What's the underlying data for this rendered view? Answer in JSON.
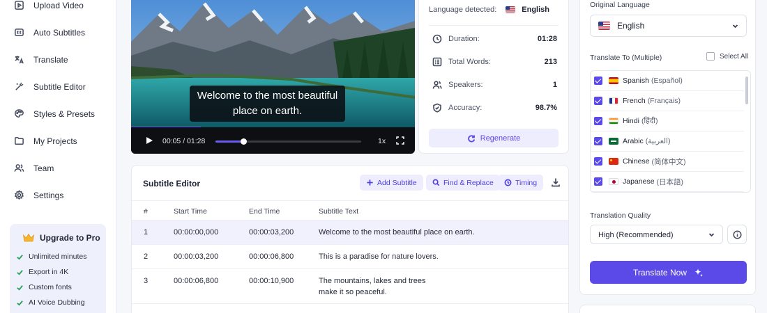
{
  "sidebar": {
    "items": [
      {
        "label": "Upload Video",
        "icon": "play-square-icon"
      },
      {
        "label": "Auto Subtitles",
        "icon": "cc-icon"
      },
      {
        "label": "Translate",
        "icon": "translate-icon"
      },
      {
        "label": "Subtitle Editor",
        "icon": "magic-wand-icon"
      },
      {
        "label": "Styles & Presets",
        "icon": "palette-icon"
      },
      {
        "label": "My Projects",
        "icon": "folder-icon"
      },
      {
        "label": "Team",
        "icon": "team-icon"
      },
      {
        "label": "Settings",
        "icon": "gear-icon"
      }
    ],
    "upgrade": {
      "title": "Upgrade to Pro",
      "features": [
        "Unlimited minutes",
        "Export in 4K",
        "Custom fonts",
        "AI Voice Dubbing"
      ]
    }
  },
  "video": {
    "caption_line1": "Welcome to the most beautiful",
    "caption_line2": "place on earth.",
    "timecode": "00:05 / 01:28",
    "progress": 0.19,
    "speed": "1x"
  },
  "stats": {
    "language_label": "Language detected:",
    "language_value": "English",
    "rows": [
      {
        "label": "Duration:",
        "value": "01:28",
        "icon": "clock-icon"
      },
      {
        "label": "Total Words:",
        "value": "213",
        "icon": "list-icon"
      },
      {
        "label": "Speakers:",
        "value": "1",
        "icon": "speakers-icon"
      },
      {
        "label": "Accuracy:",
        "value": "98.7%",
        "icon": "shield-check-icon"
      }
    ],
    "regenerate_label": "Regenerate"
  },
  "editor": {
    "title": "Subtitle Editor",
    "add_label": "Add Subtitle",
    "find_label": "Find & Replace",
    "timing_label": "Timing",
    "columns": [
      "#",
      "Start Time",
      "End Time",
      "Subtitle Text"
    ],
    "rows": [
      {
        "num": "1",
        "start": "00:00:00,000",
        "end": "00:00:03,200",
        "text": "Welcome to the most beautiful place on earth.",
        "text2": ""
      },
      {
        "num": "2",
        "start": "00:00:03,200",
        "end": "00:00:06,800",
        "text": "This is a paradise for nature lovers.",
        "text2": ""
      },
      {
        "num": "3",
        "start": "00:00:06,800",
        "end": "00:00:10,900",
        "text": "The mountains, lakes and trees",
        "text2": "make it so peaceful."
      }
    ]
  },
  "panel": {
    "original_label": "Original Language",
    "original_value": "English",
    "translate_to_label": "Translate To (Multiple)",
    "select_all_label": "Select All",
    "languages": [
      {
        "name": "Spanish",
        "native": "(Español)",
        "flag": "es"
      },
      {
        "name": "French",
        "native": "(Français)",
        "flag": "fr"
      },
      {
        "name": "Hindi",
        "native": "(हिंदी)",
        "flag": "in"
      },
      {
        "name": "Arabic",
        "native": "(العربية)",
        "flag": "sa"
      },
      {
        "name": "Chinese",
        "native": "(简体中文)",
        "flag": "cn"
      },
      {
        "name": "Japanese",
        "native": "(日本語)",
        "flag": "jp"
      }
    ],
    "quality_label": "Translation Quality",
    "quality_value": "High (Recommended)",
    "translate_button": "Translate Now"
  },
  "colors": {
    "accent": "#5b49e8",
    "accent_light": "#eeedfd",
    "success": "#27a35b"
  }
}
